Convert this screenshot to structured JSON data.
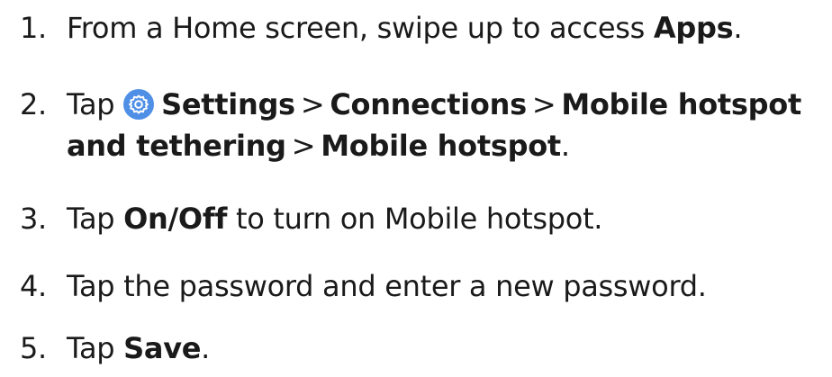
{
  "steps": [
    {
      "number": "1.",
      "text_before": "From a Home screen, swipe up to access ",
      "bold": "Apps",
      "text_after": "."
    },
    {
      "number": "2.",
      "prefix": "Tap ",
      "icon": "settings-gear-icon",
      "icon_color": "#4f8fe6",
      "path": [
        "Settings",
        "Connections",
        "Mobile hotspot"
      ],
      "separator": ">",
      "path_line2": [
        "and tethering",
        "Mobile hotspot"
      ],
      "suffix": "."
    },
    {
      "number": "3.",
      "prefix": "Tap ",
      "bold": "On/Off",
      "text_after": " to turn on Mobile hotspot."
    },
    {
      "number": "4.",
      "text": "Tap the password and enter a new password."
    },
    {
      "number": "5.",
      "prefix": "Tap ",
      "bold": "Save",
      "text_after": "."
    }
  ]
}
